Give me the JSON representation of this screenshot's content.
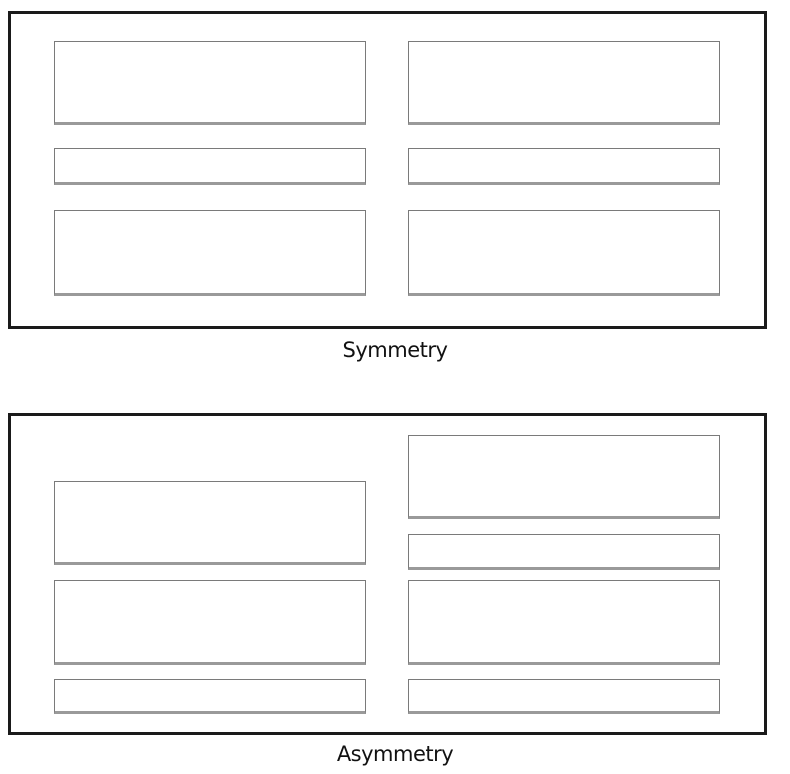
{
  "diagrams": [
    {
      "caption": "Symmetry"
    },
    {
      "caption": "Asymmetry"
    }
  ]
}
